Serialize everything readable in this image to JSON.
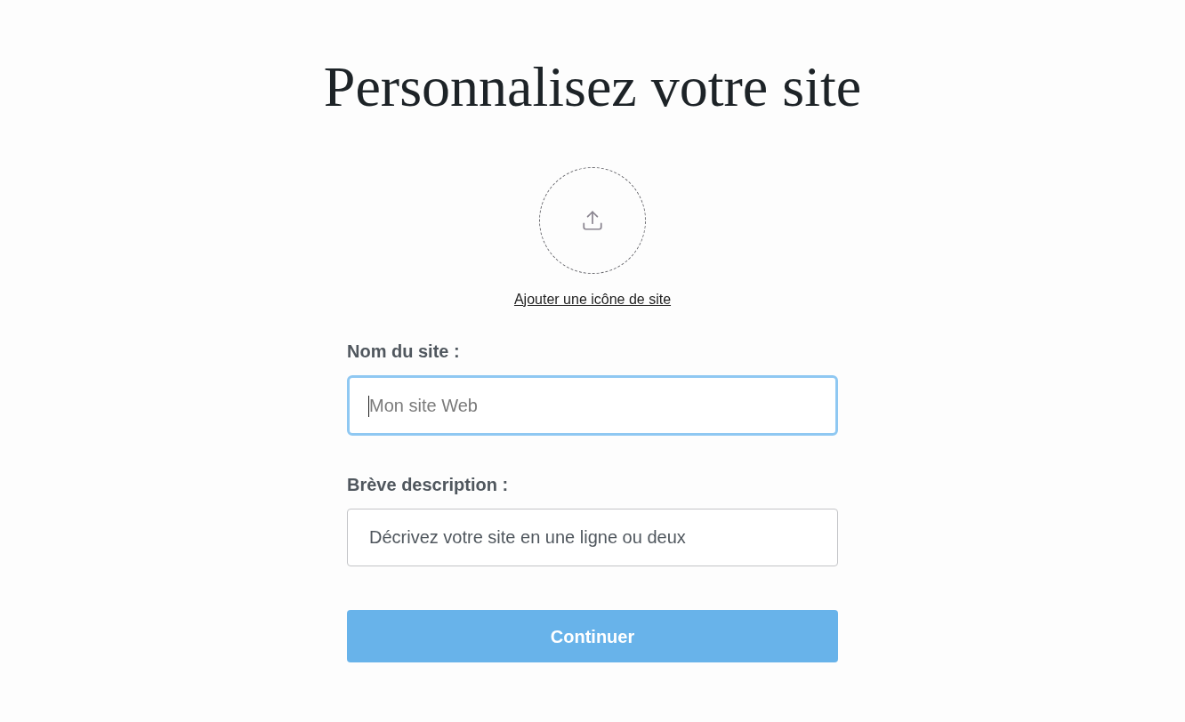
{
  "title": "Personnalisez votre site",
  "icon_upload": {
    "link": "Ajouter une icône de site"
  },
  "fields": [
    {
      "label": "Nom du site :",
      "placeholder": "Mon site Web",
      "focused": true
    },
    {
      "label": "Brève description :",
      "placeholder": "Décrivez votre site en une ligne ou deux",
      "focused": false
    }
  ],
  "button": {
    "label": "Continuer"
  }
}
